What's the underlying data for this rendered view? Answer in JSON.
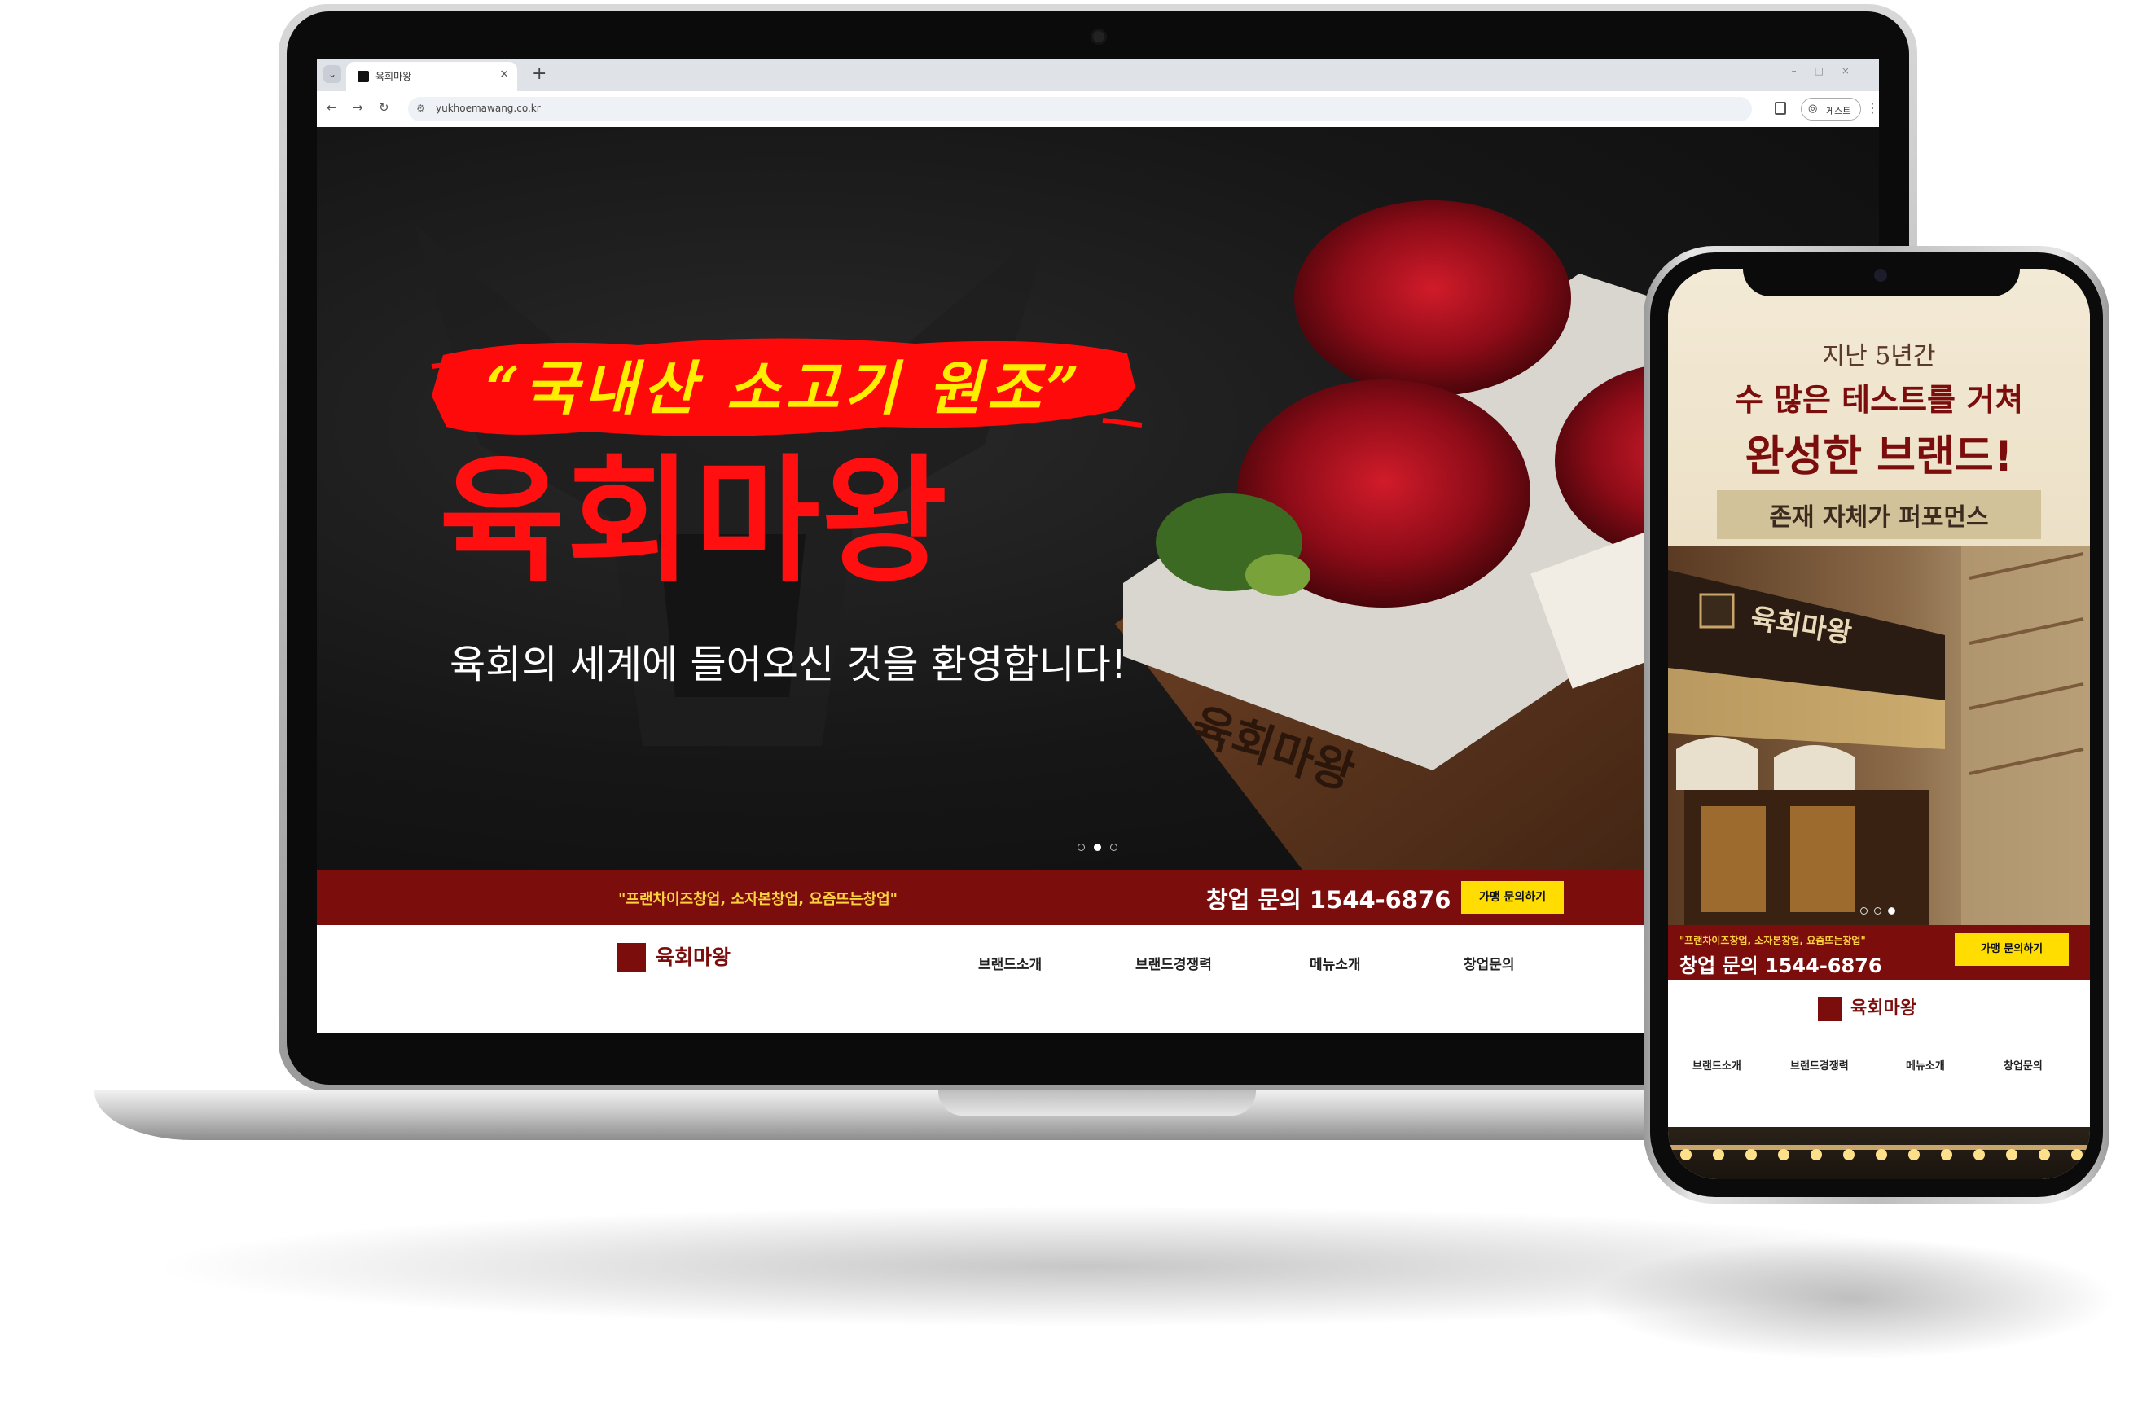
{
  "browser": {
    "tab_title": "육회마왕",
    "tab_close": "×",
    "new_tab": "+",
    "url": "yukhoemawang.co.kr",
    "guest_label": "게스트",
    "back": "←",
    "forward": "→",
    "reload": "↻"
  },
  "hero": {
    "slogan": "“국내산 소고기 원조”",
    "brand": "육회마왕",
    "welcome": "육회의 세계에 들어오신 것을 환영합니다!",
    "slide_count": 3,
    "active_slide": 2,
    "board_engraving": "육회마왕"
  },
  "promo_bar": {
    "subtitle": "\"프랜차이즈창업, 소자본창업, 요즘뜨는창업\"",
    "call": "창업 문의 1544-6876",
    "button": "가맹 문의하기"
  },
  "nav": {
    "logo_text": "육회마왕",
    "items": [
      "브랜드소개",
      "브랜드경쟁력",
      "메뉴소개",
      "창업문의"
    ]
  },
  "mobile": {
    "line1": "지난 5년간",
    "line2": "수 많은 테스트를 거쳐",
    "line3": "완성한 브랜드!",
    "line4": "존재 자체가 퍼포먼스",
    "store_sign": "육회마왕",
    "slide_count": 3,
    "active_slide": 3,
    "promo_subtitle": "\"프랜차이즈창업, 소자본창업, 요즘뜨는창업\"",
    "promo_call": "창업 문의 1544-6876",
    "promo_button": "가맹 문의하기",
    "logo_text": "육회마왕",
    "nav_items": [
      "브랜드소개",
      "브랜드경쟁력",
      "메뉴소개",
      "창업문의"
    ]
  },
  "colors": {
    "brand_red": "#7c0d0d",
    "headline_red": "#ff0f0f",
    "accent_yellow": "#ffdd00"
  }
}
